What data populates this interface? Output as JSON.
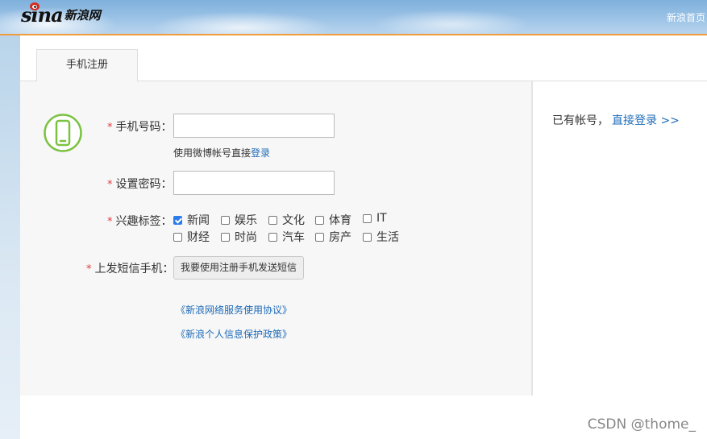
{
  "header": {
    "logo_text": "sina",
    "logo_cn": "新浪网",
    "home_link": "新浪首页"
  },
  "tabs": [
    {
      "label": "手机注册"
    }
  ],
  "form": {
    "phone": {
      "label": "手机号码：",
      "value": "",
      "hint_prefix": "使用微博帐号直接",
      "hint_link": "登录"
    },
    "password": {
      "label": "设置密码：",
      "value": ""
    },
    "interests": {
      "label": "兴趣标签：",
      "options": [
        {
          "label": "新闻",
          "checked": true
        },
        {
          "label": "娱乐",
          "checked": false
        },
        {
          "label": "文化",
          "checked": false
        },
        {
          "label": "体育",
          "checked": false
        },
        {
          "label": "IT",
          "checked": false
        },
        {
          "label": "财经",
          "checked": false
        },
        {
          "label": "时尚",
          "checked": false
        },
        {
          "label": "汽车",
          "checked": false
        },
        {
          "label": "房产",
          "checked": false
        },
        {
          "label": "生活",
          "checked": false
        }
      ]
    },
    "sms": {
      "label": "上发短信手机：",
      "button": "我要使用注册手机发送短信"
    },
    "required_mark": "*"
  },
  "links": {
    "service_agreement": "《新浪网络服务使用协议》",
    "privacy_policy": "《新浪个人信息保护政策》"
  },
  "sidebar": {
    "already_text": "已有帐号，",
    "login_link": "直接登录 >>"
  },
  "watermark": "CSDN @thome_",
  "colors": {
    "accent_orange": "#f29b3a",
    "link_blue": "#1e6bb8",
    "required_red": "#e4393c",
    "phone_icon_green": "#7cc242"
  },
  "icons": {
    "phone": "mobile-phone-icon",
    "logo_eye": "sina-eye-icon"
  }
}
